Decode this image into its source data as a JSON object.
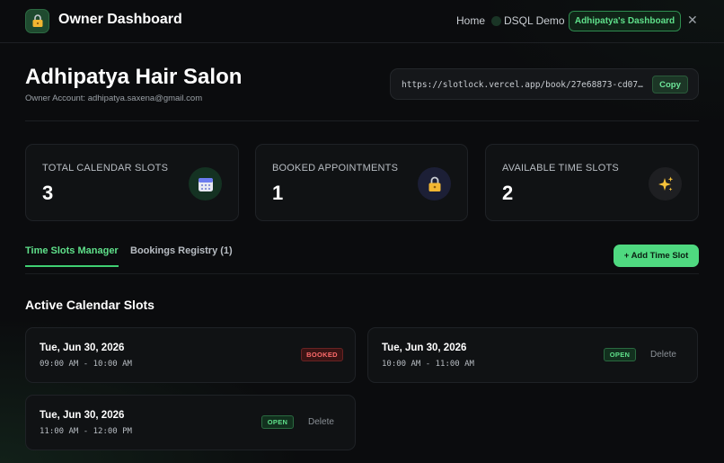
{
  "nav": {
    "title": "Owner Dashboard",
    "home": "Home",
    "dsql": "DSQL Demo",
    "dashboard": "Adhipatya's Dashboard",
    "close": "✕"
  },
  "header": {
    "salon_name": "Adhipatya Hair Salon",
    "owner_account": "Owner Account: adhipatya.saxena@gmail.com",
    "booking_url": "https://slotlock.vercel.app/book/27e68873-cd07-…",
    "copy_label": "Copy"
  },
  "stats": [
    {
      "label": "TOTAL CALENDAR SLOTS",
      "value": "3",
      "icon": "calendar-icon"
    },
    {
      "label": "BOOKED APPOINTMENTS",
      "value": "1",
      "icon": "lock-icon"
    },
    {
      "label": "AVAILABLE TIME SLOTS",
      "value": "2",
      "icon": "sparkles-icon"
    }
  ],
  "tabs": [
    {
      "label": "Time Slots Manager",
      "active": true
    },
    {
      "label": "Bookings Registry (1)",
      "active": false
    }
  ],
  "add_slot_label": "+ Add Time Slot",
  "section_title": "Active Calendar Slots",
  "slots": [
    {
      "date": "Tue, Jun 30, 2026",
      "time": "09:00 AM - 10:00 AM",
      "status": "BOOKED"
    },
    {
      "date": "Tue, Jun 30, 2026",
      "time": "10:00 AM - 11:00 AM",
      "status": "OPEN",
      "delete": "Delete"
    },
    {
      "date": "Tue, Jun 30, 2026",
      "time": "11:00 AM - 12:00 PM",
      "status": "OPEN",
      "delete": "Delete"
    }
  ],
  "colors": {
    "accent": "#5fe08a",
    "booked": "#ff6b6b",
    "background": "#0b0c0e"
  }
}
